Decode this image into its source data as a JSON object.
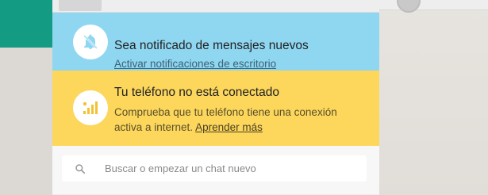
{
  "notifications_banner": {
    "title": "Sea notificado de mensajes nuevos",
    "link": "Activar notificaciones de escritorio",
    "icon": "bell-muted-icon",
    "color": "#8fd6f1"
  },
  "phone_banner": {
    "title": "Tu teléfono no está conectado",
    "body": "Comprueba que tu teléfono tiene una conexión activa a internet. ",
    "learn_more": "Aprender más",
    "icon": "phone-signal-icon",
    "color": "#fcd75c"
  },
  "search": {
    "placeholder": "Buscar o empezar un chat nuevo",
    "value": "",
    "icon": "search-icon"
  },
  "colors": {
    "accent": "#139b83"
  }
}
